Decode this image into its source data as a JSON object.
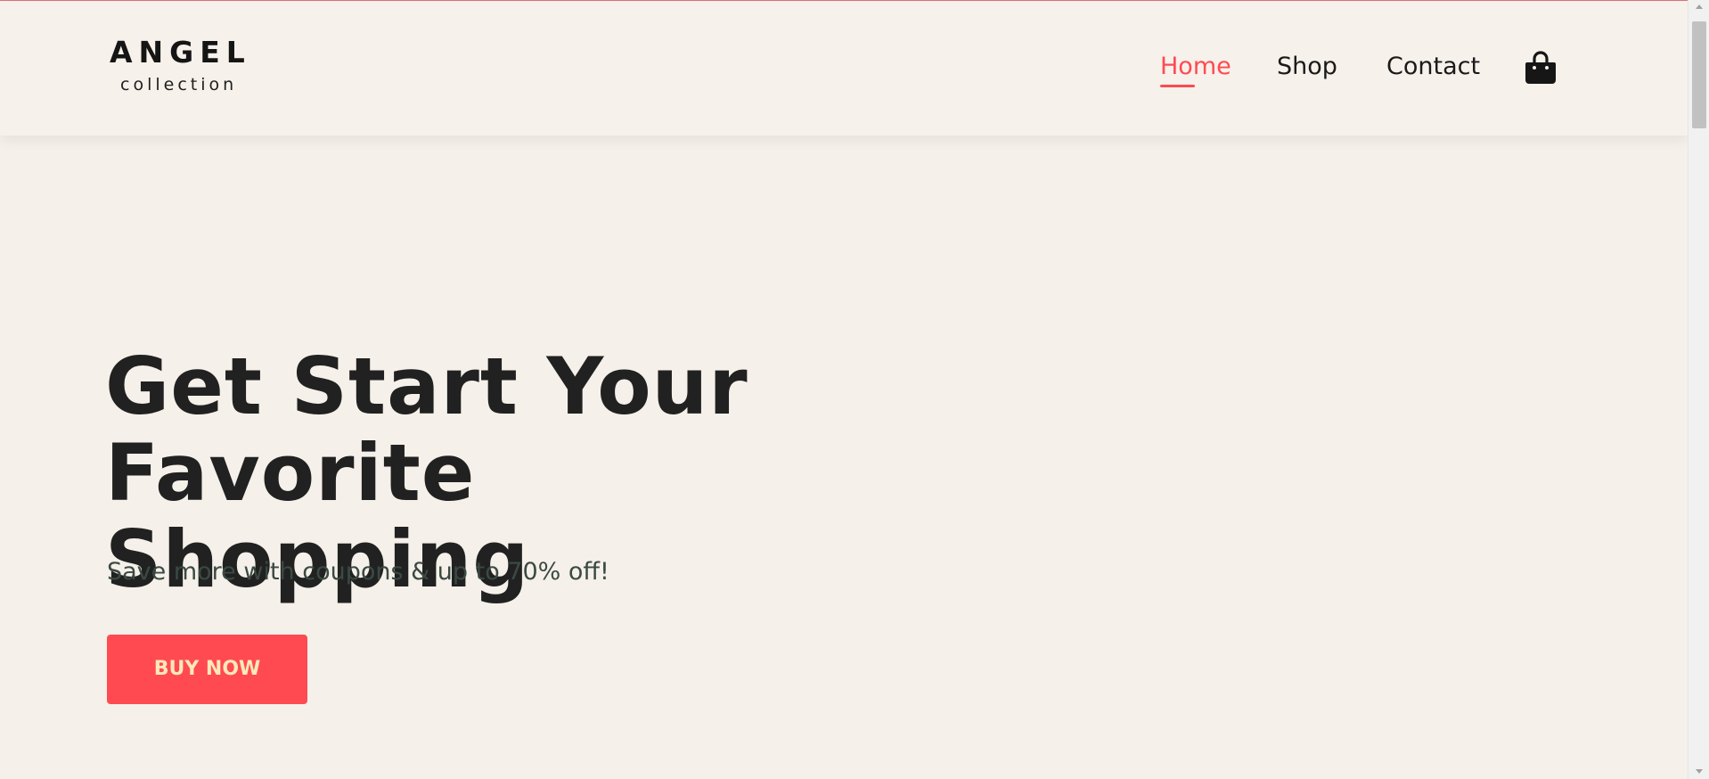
{
  "header": {
    "logo": {
      "main": "ANGEL",
      "sub": "collection"
    },
    "nav": [
      {
        "label": "Home",
        "active": true
      },
      {
        "label": "Shop",
        "active": false
      },
      {
        "label": "Contact",
        "active": false
      }
    ],
    "cart_icon": "shopping-bag-icon"
  },
  "hero": {
    "title_line1": "Get Start Your",
    "title_line2": "Favorite Shopping",
    "subtitle": "Save more with coupons & up to 70% off!",
    "button_label": "BUY NOW"
  },
  "colors": {
    "background": "#f5f0e9",
    "accent": "#ff4a52",
    "button_text": "#ffe9b8",
    "text_dark": "#212121"
  }
}
